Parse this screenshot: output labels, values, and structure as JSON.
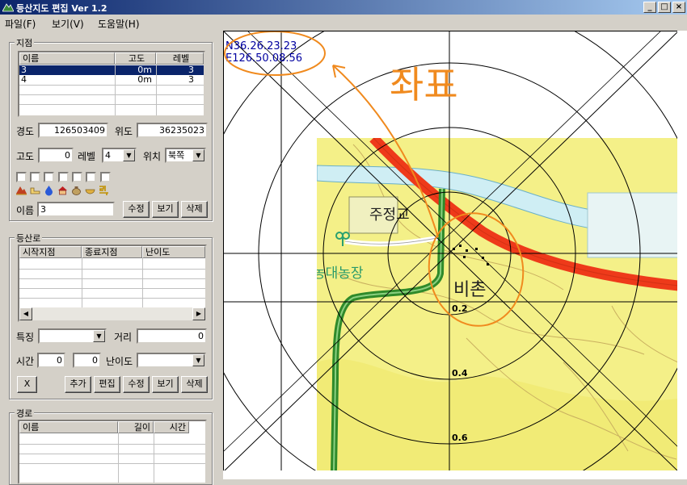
{
  "window": {
    "title": "등산지도 편집 Ver 1.2",
    "buttons": {
      "minimize": "_",
      "maximize": "□",
      "close": "×"
    }
  },
  "menu": [
    "파일(F)",
    "보기(V)",
    "도움말(H)"
  ],
  "points": {
    "group_label": "지점",
    "columns": [
      "이름",
      "고도",
      "레벨"
    ],
    "rows": [
      {
        "name": "3",
        "altitude": "0m",
        "level": "3",
        "selected": true
      },
      {
        "name": "4",
        "altitude": "0m",
        "level": "3",
        "selected": false
      }
    ],
    "longitude_label": "경도",
    "longitude_value": "126503409",
    "latitude_label": "위도",
    "latitude_value": "36235023",
    "altitude_label": "고도",
    "altitude_value": "0",
    "level_label": "레벨",
    "level_value": "4",
    "position_label": "위치",
    "position_value": "북쪽",
    "name_label": "이름",
    "name_value": "3",
    "edit_button": "수정",
    "view_button": "보기",
    "delete_button": "삭제",
    "type_icons": [
      "peak-icon",
      "water-icon",
      "drop-icon",
      "shelter-icon",
      "bag-icon",
      "bowl-icon",
      "temple-icon"
    ]
  },
  "trail": {
    "group_label": "등산로",
    "columns": [
      "시작지점",
      "종료지점",
      "난이도"
    ],
    "feature_label": "특징",
    "distance_label": "거리",
    "distance_value": "0",
    "time_label": "시간",
    "time_hours": "0",
    "time_minutes": "0",
    "difficulty_label": "난이도",
    "x_button": "X",
    "add_button": "추가",
    "editing_button": "편집",
    "edit_button": "수정",
    "view_button": "보기",
    "delete_button": "삭제"
  },
  "route": {
    "group_label": "경로",
    "columns": [
      "이름",
      "길이",
      "시간"
    ]
  },
  "map": {
    "coord_n": "N36.26.23.23",
    "coord_e": "E126.50.08.56",
    "annotation": "좌표",
    "place_bridge": "주정교",
    "place_farm": "농대농장",
    "place_village": "비촌",
    "ring_labels": [
      "0.2",
      "0.4",
      "0.6"
    ],
    "colors": {
      "road": "#ee3a1a",
      "trail": "#2f8a2a",
      "land": "#f4f088",
      "water": "#cfeef4",
      "annotation": "#f08a1e",
      "coord_text": "#0000a0"
    }
  }
}
